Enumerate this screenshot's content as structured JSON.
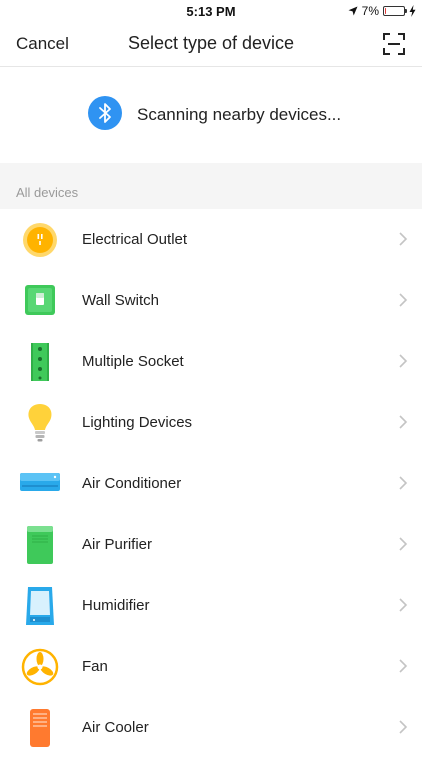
{
  "status_bar": {
    "time": "5:13 PM",
    "battery_percent": "7%",
    "battery_level": 0.07
  },
  "header": {
    "cancel_label": "Cancel",
    "title": "Select type of device"
  },
  "scanning": {
    "text": "Scanning nearby devices..."
  },
  "section": {
    "title": "All devices"
  },
  "devices": [
    {
      "label": "Electrical Outlet",
      "icon": "electrical-outlet-icon"
    },
    {
      "label": "Wall Switch",
      "icon": "wall-switch-icon"
    },
    {
      "label": "Multiple Socket",
      "icon": "multiple-socket-icon"
    },
    {
      "label": "Lighting Devices",
      "icon": "light-bulb-icon"
    },
    {
      "label": "Air Conditioner",
      "icon": "air-conditioner-icon"
    },
    {
      "label": "Air Purifier",
      "icon": "air-purifier-icon"
    },
    {
      "label": "Humidifier",
      "icon": "humidifier-icon"
    },
    {
      "label": "Fan",
      "icon": "fan-icon"
    },
    {
      "label": "Air Cooler",
      "icon": "air-cooler-icon"
    }
  ],
  "colors": {
    "bluetooth": "#2f93f2",
    "battery_low": "#e03a3a",
    "section_bg": "#f5f5f5"
  }
}
